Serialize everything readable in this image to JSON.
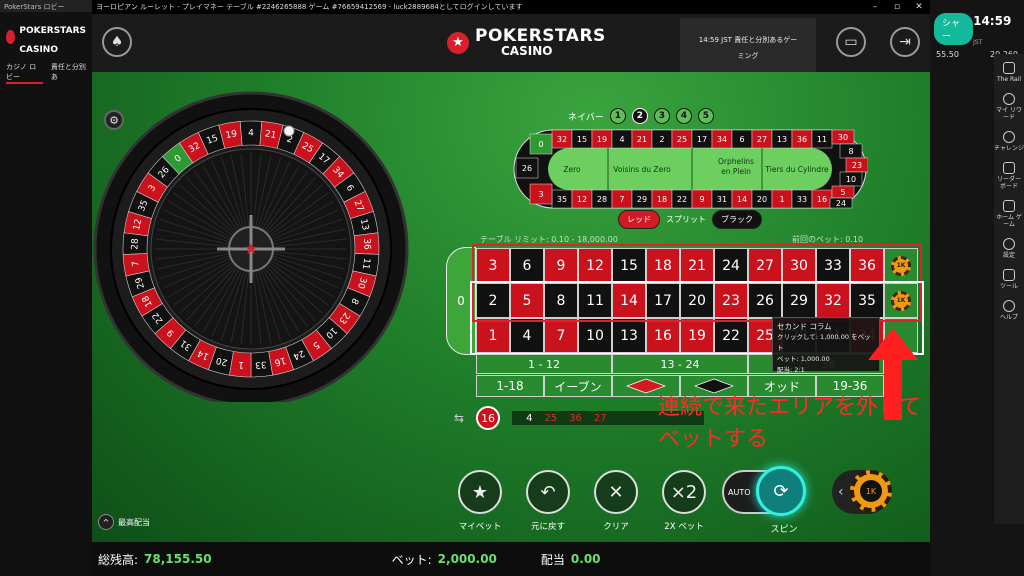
{
  "lobby": {
    "window_title": "PokerStars ロビー",
    "brand_line1": "POKERSTARS",
    "brand_line2": "CASINO",
    "tabs": [
      "カジノ ロビー",
      "責任と分別あ"
    ]
  },
  "titlebar": {
    "text": "ヨーロピアン ルーレット - プレイマネー テーブル #2246265888 ゲーム #76659412569 - luck2889684としてログインしています"
  },
  "header": {
    "logo_name": "POKERSTARS",
    "logo_sub": "CASINO",
    "session_line1": "14:59 JST 責任と分別あるゲー",
    "session_line2": "ミング"
  },
  "right_panel": {
    "button_partial": "シャー",
    "clock": "14:59",
    "clock_zone": "JST",
    "balance_left": "55.50",
    "balance_right": "20,260",
    "sidebar": [
      {
        "label": "The Rail",
        "icon": "rail-icon"
      },
      {
        "label": "マイ リワード",
        "icon": "reward-icon"
      },
      {
        "label": "チャレンジ",
        "icon": "challenge-icon"
      },
      {
        "label": "リーダー ボード",
        "icon": "leaderboard-icon"
      },
      {
        "label": "ホーム ゲーム",
        "icon": "home-icon"
      },
      {
        "label": "設定",
        "icon": "gear-icon"
      },
      {
        "label": "ツール",
        "icon": "wrench-icon"
      },
      {
        "label": "ヘルプ",
        "icon": "help-icon"
      }
    ]
  },
  "wheel": {
    "numbers": [
      "0",
      "32",
      "15",
      "19",
      "4",
      "21",
      "2",
      "25",
      "17",
      "34",
      "6",
      "27",
      "13",
      "36",
      "11",
      "30",
      "8",
      "23",
      "10",
      "5",
      "24",
      "16",
      "33",
      "1",
      "20",
      "14",
      "31",
      "9",
      "22",
      "18",
      "29",
      "7",
      "28",
      "12",
      "35",
      "3",
      "26"
    ]
  },
  "racetrack": {
    "neighbors_label": "ネイバー",
    "neighbors": [
      "1",
      "2",
      "3",
      "4",
      "5"
    ],
    "neighbors_selected": "2",
    "top_row": [
      "32",
      "15",
      "19",
      "4",
      "21",
      "2",
      "25",
      "17",
      "34",
      "6",
      "27",
      "13",
      "36",
      "11"
    ],
    "bottom_row": [
      "35",
      "12",
      "28",
      "7",
      "29",
      "18",
      "22",
      "9",
      "31",
      "14",
      "20",
      "1",
      "33",
      "16"
    ],
    "left_col": [
      "0",
      "26",
      "3"
    ],
    "right_col": [
      "30",
      "8",
      "23",
      "10",
      "5",
      "24"
    ],
    "sections": [
      "Zero",
      "Voisins du Zero",
      "Orphelins en Plein",
      "Tiers du Cylindre"
    ],
    "toggle_red": "レッド",
    "toggle_split": "スプリット",
    "toggle_black": "ブラック"
  },
  "board": {
    "limit_label": "テーブル リミット: 0.10 - 18,000.00",
    "last_bet_label": "前回のベット: 0.10",
    "zero": "0",
    "row_top": [
      "3",
      "6",
      "9",
      "12",
      "15",
      "18",
      "21",
      "24",
      "27",
      "30",
      "33",
      "36"
    ],
    "row_mid": [
      "2",
      "5",
      "8",
      "11",
      "14",
      "17",
      "20",
      "23",
      "26",
      "29",
      "32",
      "35"
    ],
    "row_bot": [
      "1",
      "4",
      "7",
      "10",
      "13",
      "16",
      "19",
      "22",
      "25",
      "28",
      "31",
      "34"
    ],
    "reds": [
      "1",
      "3",
      "5",
      "7",
      "9",
      "12",
      "14",
      "16",
      "18",
      "19",
      "21",
      "23",
      "25",
      "27",
      "30",
      "32",
      "34",
      "36"
    ],
    "column_chip": "1K",
    "dozens": [
      "1 - 12",
      "13 - 24",
      "25 - 36"
    ],
    "outside": [
      "1-18",
      "イーブン",
      "",
      "",
      "オッド",
      "19-36"
    ],
    "tooltip_title": "セカンド コラム",
    "tooltip_line1": "クリックして: 1,000.00 をベット",
    "tooltip_line2": "ト",
    "tooltip_line3": "ベット: 1,000.00",
    "tooltip_line4": "配当: 2:1"
  },
  "history": {
    "current": "16",
    "recent": [
      "4",
      "25",
      "36",
      "27"
    ],
    "recent_colors": [
      "#ffffff",
      "#e02a2a",
      "#e02a2a",
      "#e02a2a"
    ]
  },
  "annotation": {
    "line1": "連続で来たエリアを外して",
    "line2": "ベットする",
    "color": "#ff2b2b"
  },
  "actions": {
    "my_bets": "マイベット",
    "undo": "元に戻す",
    "clear": "クリア",
    "double": "2X ベット",
    "double_icon_text": "×2",
    "auto": "AUTO",
    "spin": "スピン",
    "chip_value": "1K",
    "max_bet": "最高配当"
  },
  "footer": {
    "balance_label": "総残高:",
    "balance_value": "78,155.50",
    "bet_label": "ベット:",
    "bet_value": "2,000.00",
    "payout_label": "配当",
    "payout_value": "0.00"
  },
  "colors": {
    "red": "#c9121c",
    "black": "#111111",
    "felt": "#1f7f2a",
    "accent_teal": "#31f0e0"
  }
}
